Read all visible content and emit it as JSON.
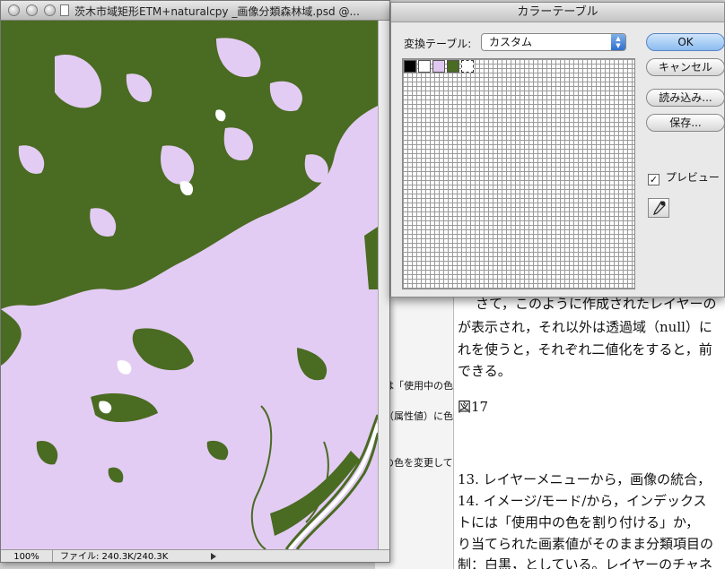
{
  "image_window": {
    "title": "茨木市域矩形ETM+naturalcpy _画像分類森林域.psd @...",
    "zoom": "100%",
    "file_info": "ファイル: 240.3K/240.3K"
  },
  "dialog": {
    "title": "カラーテーブル",
    "table_label": "変換テーブル:",
    "table_value": "カスタム",
    "ok": "OK",
    "cancel": "キャンセル",
    "load": "読み込み...",
    "save": "保存...",
    "preview": "プレビュー",
    "swatch_colors": [
      "#000000",
      "#ffffff",
      "#e0c8f0",
      "#4a6b22",
      "#ffffff"
    ]
  },
  "background_document": {
    "left_fragments": [
      "は「使用中の色",
      "（属性値）に色",
      "の色を変更して"
    ],
    "lines": [
      "さて，このように作成されたレイヤーの",
      "が表示され，それ以外は透過域（null）に",
      "れを使うと，それぞれ二値化をすると，前",
      "できる。",
      "図17",
      "13. レイヤーメニューから，画像の統合，",
      "14. イメージ/モード/から，インデックス",
      "トには「使用中の色を割り付ける」か，",
      "り当てられた画素値がそのまま分類項目の",
      "制：白黒，としている。レイヤーのチャネ"
    ]
  },
  "map": {
    "forest_color": "#4a6b22",
    "other_color": "#e3ccf3"
  }
}
